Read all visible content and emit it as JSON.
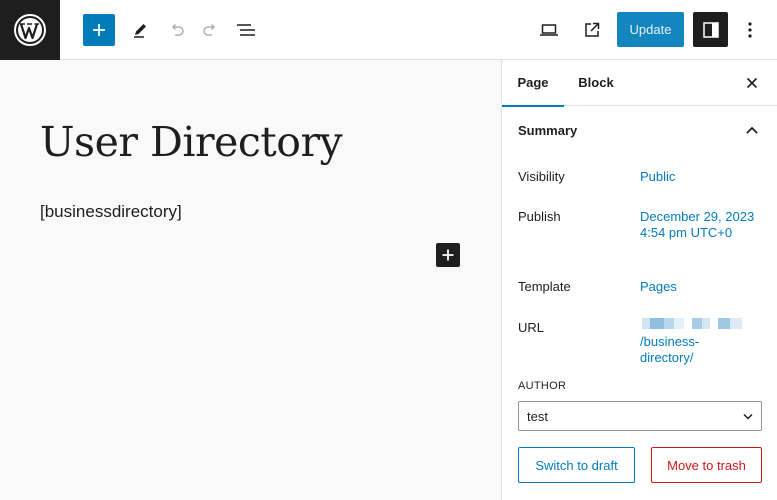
{
  "toolbar": {
    "logo_icon": "wordpress-logo-icon",
    "inserter_icon": "plus-icon",
    "tools_icon": "pencil-icon",
    "undo_icon": "undo-icon",
    "redo_icon": "redo-icon",
    "list_view_icon": "list-view-icon",
    "preview_icon": "desktop-preview-icon",
    "view_page_icon": "external-link-icon",
    "update_label": "Update",
    "settings_icon": "sidebar-toggle-icon",
    "options_icon": "more-vertical-icon",
    "accent_color": "#007cba"
  },
  "editor": {
    "title": "User Directory",
    "shortcode": "[businessdirectory]",
    "block_inserter_icon": "plus-icon"
  },
  "sidebar": {
    "tabs": [
      {
        "label": "Page",
        "active": true
      },
      {
        "label": "Block",
        "active": false
      }
    ],
    "close_icon": "close-icon",
    "summary": {
      "title": "Summary",
      "chevron_icon": "chevron-up-icon",
      "rows": [
        {
          "label": "Visibility",
          "value": "Public"
        },
        {
          "label": "Publish",
          "value": "December 29, 2023 4:54 pm UTC+0"
        },
        {
          "label": "Template",
          "value": "Pages"
        },
        {
          "label": "URL",
          "value": "/business-directory/"
        }
      ]
    },
    "author": {
      "label": "AUTHOR",
      "value": "test",
      "chevron_icon": "chevron-down-icon"
    },
    "actions": {
      "switch_to_draft": "Switch to draft",
      "move_to_trash": "Move to trash",
      "trash_color": "#cc1818"
    }
  }
}
